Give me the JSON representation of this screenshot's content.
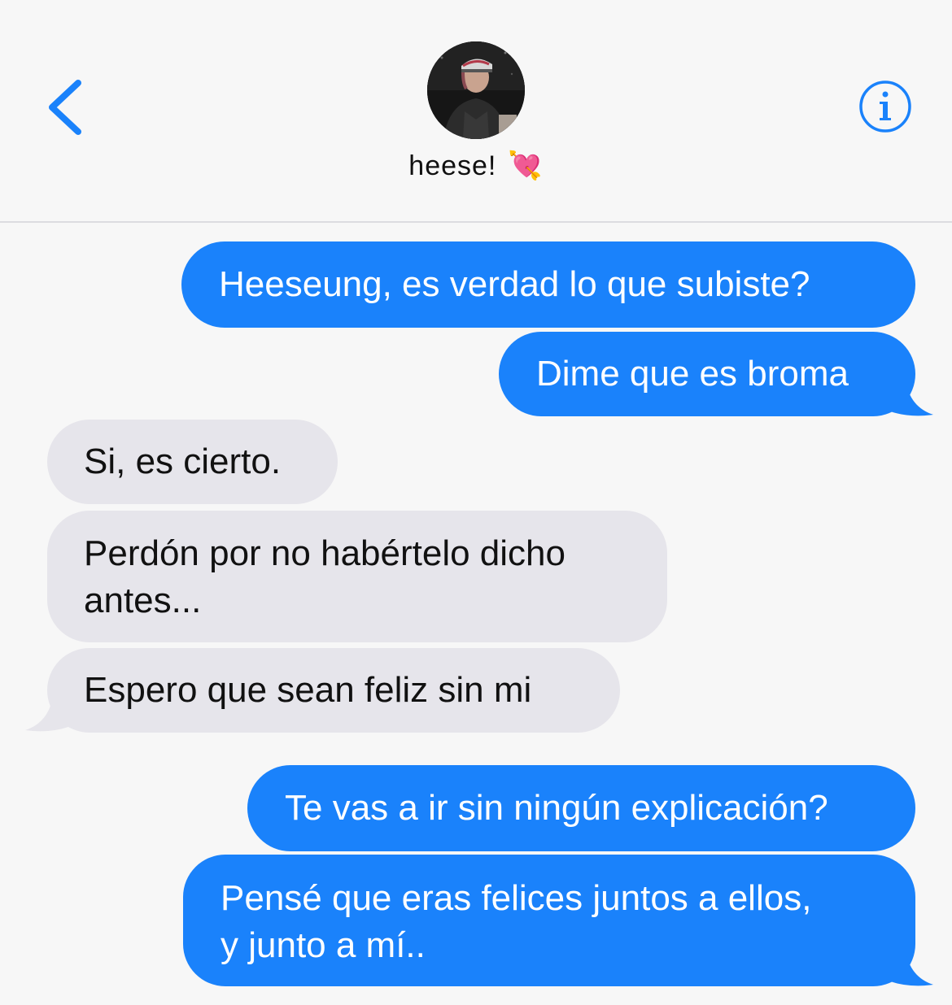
{
  "header": {
    "contact_name": "heese!",
    "contact_emoji": "💘",
    "back_icon": "chevron-left-icon",
    "info_icon": "info-circle-icon",
    "accent_color": "#1a82fb"
  },
  "messages": [
    {
      "direction": "sent",
      "text": "Heeseung, es verdad lo que subiste?"
    },
    {
      "direction": "sent",
      "text": "Dime que es broma"
    },
    {
      "direction": "received",
      "text": "Si, es cierto."
    },
    {
      "direction": "received",
      "lines": [
        "Perdón por no habértelo dicho",
        "antes..."
      ]
    },
    {
      "direction": "received",
      "text": "Espero que sean feliz sin mi"
    },
    {
      "direction": "sent",
      "text": "Te vas a ir sin ningún explicación?"
    },
    {
      "direction": "sent",
      "lines": [
        "Pensé que eras felices juntos a ellos,",
        "y junto a mí.."
      ]
    }
  ],
  "colors": {
    "sent_bubble": "#1a82fb",
    "received_bubble": "#e6e5eb",
    "background": "#f7f7f7"
  }
}
